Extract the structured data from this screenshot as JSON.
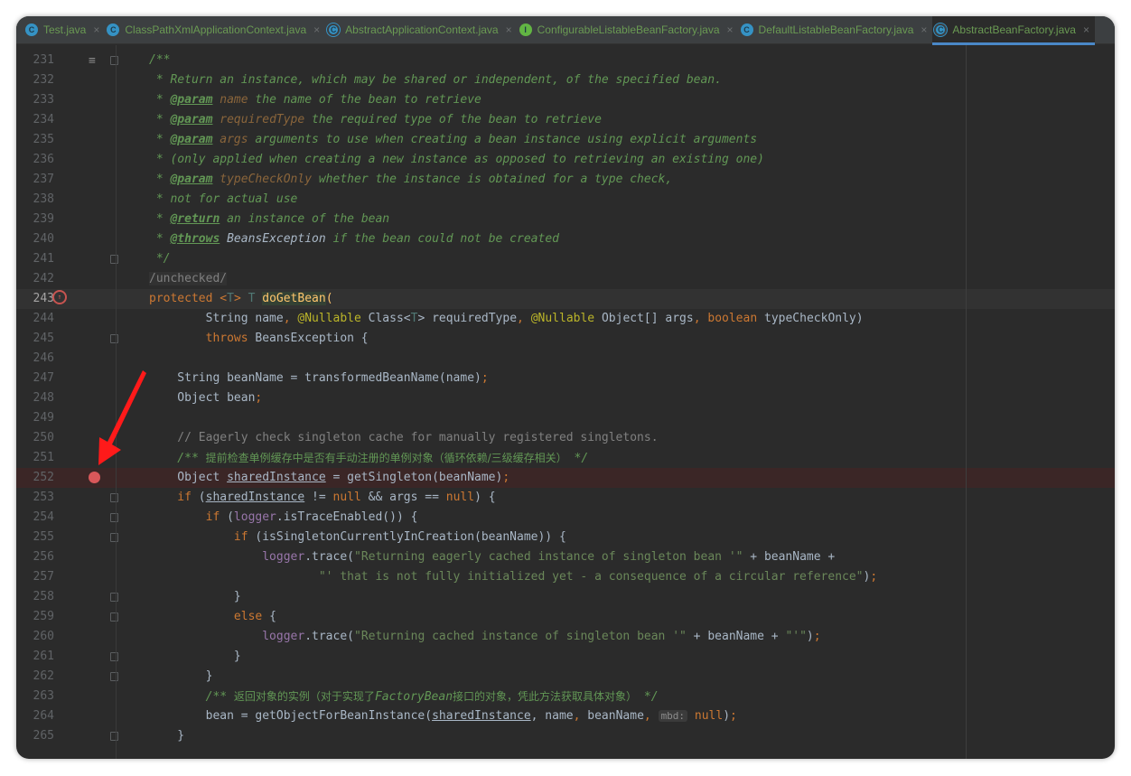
{
  "tabs": [
    {
      "label": "Test.java",
      "icon": "class-run-icon",
      "kind": "c"
    },
    {
      "label": "ClassPathXmlApplicationContext.java",
      "icon": "class-icon",
      "kind": "c"
    },
    {
      "label": "AbstractApplicationContext.java",
      "icon": "abstract-class-icon",
      "kind": "abs"
    },
    {
      "label": "ConfigurableListableBeanFactory.java",
      "icon": "interface-icon",
      "kind": "i"
    },
    {
      "label": "DefaultListableBeanFactory.java",
      "icon": "class-icon",
      "kind": "c"
    },
    {
      "label": "AbstractBeanFactory.java",
      "icon": "abstract-class-icon",
      "kind": "abs",
      "active": true
    }
  ],
  "close_glyph": "×",
  "breakpoint_line": 252,
  "current_line": 243,
  "colors": {
    "breakpoint": "#d8585a",
    "arrow": "#ff1a1a",
    "tab_active_underline": "#4a88c7"
  },
  "lines": [
    {
      "n": 231,
      "t": [
        [
          "/**",
          "dc"
        ]
      ],
      "fold": true
    },
    {
      "n": 232,
      "t": [
        [
          " * Return an instance, which may be shared or independent, of the specified bean.",
          "dc"
        ]
      ]
    },
    {
      "n": 233,
      "t": [
        [
          " * ",
          "dc"
        ],
        [
          "@param",
          "dt"
        ],
        [
          " name",
          "dp"
        ],
        [
          " the name of the bean to retrieve",
          "dc"
        ]
      ]
    },
    {
      "n": 234,
      "t": [
        [
          " * ",
          "dc"
        ],
        [
          "@param",
          "dt"
        ],
        [
          " requiredType",
          "dp"
        ],
        [
          " the required type of the bean to retrieve",
          "dc"
        ]
      ]
    },
    {
      "n": 235,
      "t": [
        [
          " * ",
          "dc"
        ],
        [
          "@param",
          "dt"
        ],
        [
          " args",
          "dp"
        ],
        [
          " arguments to use when creating a bean instance using explicit arguments",
          "dc"
        ]
      ]
    },
    {
      "n": 236,
      "t": [
        [
          " * (only applied when creating a new instance as opposed to retrieving an existing one)",
          "dc"
        ]
      ]
    },
    {
      "n": 237,
      "t": [
        [
          " * ",
          "dc"
        ],
        [
          "@param",
          "dt"
        ],
        [
          " typeCheckOnly",
          "dp"
        ],
        [
          " whether the instance is obtained for a type check,",
          "dc"
        ]
      ]
    },
    {
      "n": 238,
      "t": [
        [
          " * not for actual use",
          "dc"
        ]
      ]
    },
    {
      "n": 239,
      "t": [
        [
          " * ",
          "dc"
        ],
        [
          "@return",
          "dt"
        ],
        [
          " an instance of the bean",
          "dc"
        ]
      ]
    },
    {
      "n": 240,
      "t": [
        [
          " * ",
          "dc"
        ],
        [
          "@throws",
          "dt"
        ],
        [
          " BeansException",
          "dcb"
        ],
        [
          " if the bean could not be created",
          "dc"
        ]
      ]
    },
    {
      "n": 241,
      "t": [
        [
          " */",
          "dc"
        ]
      ],
      "fold": true
    },
    {
      "n": 242,
      "t": [
        [
          "/unchecked/",
          "sup"
        ]
      ]
    },
    {
      "n": 243,
      "t": [
        [
          "protected ",
          "kw"
        ],
        [
          "<",
          "kw"
        ],
        [
          "T",
          "tp"
        ],
        [
          "> ",
          "kw"
        ],
        [
          "T ",
          "tp"
        ],
        [
          "doGetBean",
          "mh"
        ],
        [
          "(",
          "mt"
        ]
      ]
    },
    {
      "n": 244,
      "t": [
        [
          "        String name",
          ""
        ],
        [
          ", ",
          "kw"
        ],
        [
          "@Nullable ",
          "an"
        ],
        [
          "Class<",
          ""
        ],
        [
          "T",
          "tp"
        ],
        [
          "> requiredType",
          ""
        ],
        [
          ", ",
          "kw"
        ],
        [
          "@Nullable ",
          "an"
        ],
        [
          "Object[] args",
          ""
        ],
        [
          ", ",
          "kw"
        ],
        [
          "boolean ",
          "kw"
        ],
        [
          "typeCheckOnly)",
          ""
        ]
      ]
    },
    {
      "n": 245,
      "t": [
        [
          "        throws ",
          "kw"
        ],
        [
          "BeansException {",
          ""
        ]
      ],
      "fold": true
    },
    {
      "n": 246,
      "t": []
    },
    {
      "n": 247,
      "t": [
        [
          "    String beanName = transformedBeanName(name)",
          ""
        ],
        [
          ";",
          "kw"
        ]
      ]
    },
    {
      "n": 248,
      "t": [
        [
          "    Object bean",
          ""
        ],
        [
          ";",
          "kw"
        ]
      ]
    },
    {
      "n": 249,
      "t": []
    },
    {
      "n": 250,
      "t": [
        [
          "    // Eagerly check singleton cache for manually registered singletons.",
          "cm"
        ]
      ]
    },
    {
      "n": 251,
      "t": [
        [
          "    /** ",
          "dc"
        ],
        [
          "提前检查单例缓存中是否有手动注册的单例对象（循环依赖/三级缓存相关）",
          "zh"
        ],
        [
          " */",
          "dc"
        ]
      ]
    },
    {
      "n": 252,
      "t": [
        [
          "    Object ",
          ""
        ],
        [
          "sharedInstance",
          "ul"
        ],
        [
          " = getSingleton(beanName)",
          ""
        ],
        [
          ";",
          "kw"
        ]
      ]
    },
    {
      "n": 253,
      "t": [
        [
          "    if ",
          "kw"
        ],
        [
          "(",
          ""
        ],
        [
          "sharedInstance",
          "ul"
        ],
        [
          " != ",
          ""
        ],
        [
          "null ",
          "kw"
        ],
        [
          "&& args == ",
          ""
        ],
        [
          "null",
          "kw"
        ],
        [
          ") {",
          ""
        ]
      ],
      "fold": true
    },
    {
      "n": 254,
      "t": [
        [
          "        if ",
          "kw"
        ],
        [
          "(",
          ""
        ],
        [
          "logger",
          "fd"
        ],
        [
          ".isTraceEnabled()) {",
          ""
        ]
      ],
      "fold": true
    },
    {
      "n": 255,
      "t": [
        [
          "            if ",
          "kw"
        ],
        [
          "(isSingletonCurrentlyInCreation(beanName)) {",
          ""
        ]
      ],
      "fold": true
    },
    {
      "n": 256,
      "t": [
        [
          "                ",
          ""
        ],
        [
          "logger",
          "fd"
        ],
        [
          ".trace(",
          ""
        ],
        [
          "\"Returning eagerly cached instance of singleton bean '\"",
          "st"
        ],
        [
          " + beanName +",
          ""
        ]
      ]
    },
    {
      "n": 257,
      "t": [
        [
          "                        ",
          ""
        ],
        [
          "\"' that is not fully initialized yet - a consequence of a circular reference\"",
          "st"
        ],
        [
          ")",
          ""
        ],
        [
          ";",
          "kw"
        ]
      ]
    },
    {
      "n": 258,
      "t": [
        [
          "            }",
          ""
        ]
      ],
      "fold": true
    },
    {
      "n": 259,
      "t": [
        [
          "            else ",
          "kw"
        ],
        [
          "{",
          ""
        ]
      ],
      "fold": true
    },
    {
      "n": 260,
      "t": [
        [
          "                ",
          ""
        ],
        [
          "logger",
          "fd"
        ],
        [
          ".trace(",
          ""
        ],
        [
          "\"Returning cached instance of singleton bean '\"",
          "st"
        ],
        [
          " + beanName + ",
          ""
        ],
        [
          "\"'\"",
          "st"
        ],
        [
          ")",
          ""
        ],
        [
          ";",
          "kw"
        ]
      ]
    },
    {
      "n": 261,
      "t": [
        [
          "            }",
          ""
        ]
      ],
      "fold": true
    },
    {
      "n": 262,
      "t": [
        [
          "        }",
          ""
        ]
      ],
      "fold": true
    },
    {
      "n": 263,
      "t": [
        [
          "        /** ",
          "dc"
        ],
        [
          "返回对象的实例（对于实现了",
          "zh"
        ],
        [
          "FactoryBean",
          "dc"
        ],
        [
          "接口的对象，凭此方法获取具体对象）",
          "zh"
        ],
        [
          " */",
          "dc"
        ]
      ]
    },
    {
      "n": 264,
      "t": [
        [
          "        bean = getObjectForBeanInstance(",
          ""
        ],
        [
          "sharedInstance",
          "ul"
        ],
        [
          ", name",
          ""
        ],
        [
          ", ",
          "kw"
        ],
        [
          "beanName",
          ""
        ],
        [
          ", ",
          "kw"
        ],
        [
          "mbd:",
          "hint"
        ],
        [
          " null",
          "kw"
        ],
        [
          ")",
          ""
        ],
        [
          ";",
          "kw"
        ]
      ]
    },
    {
      "n": 265,
      "t": [
        [
          "    }",
          ""
        ]
      ],
      "fold": true
    }
  ]
}
